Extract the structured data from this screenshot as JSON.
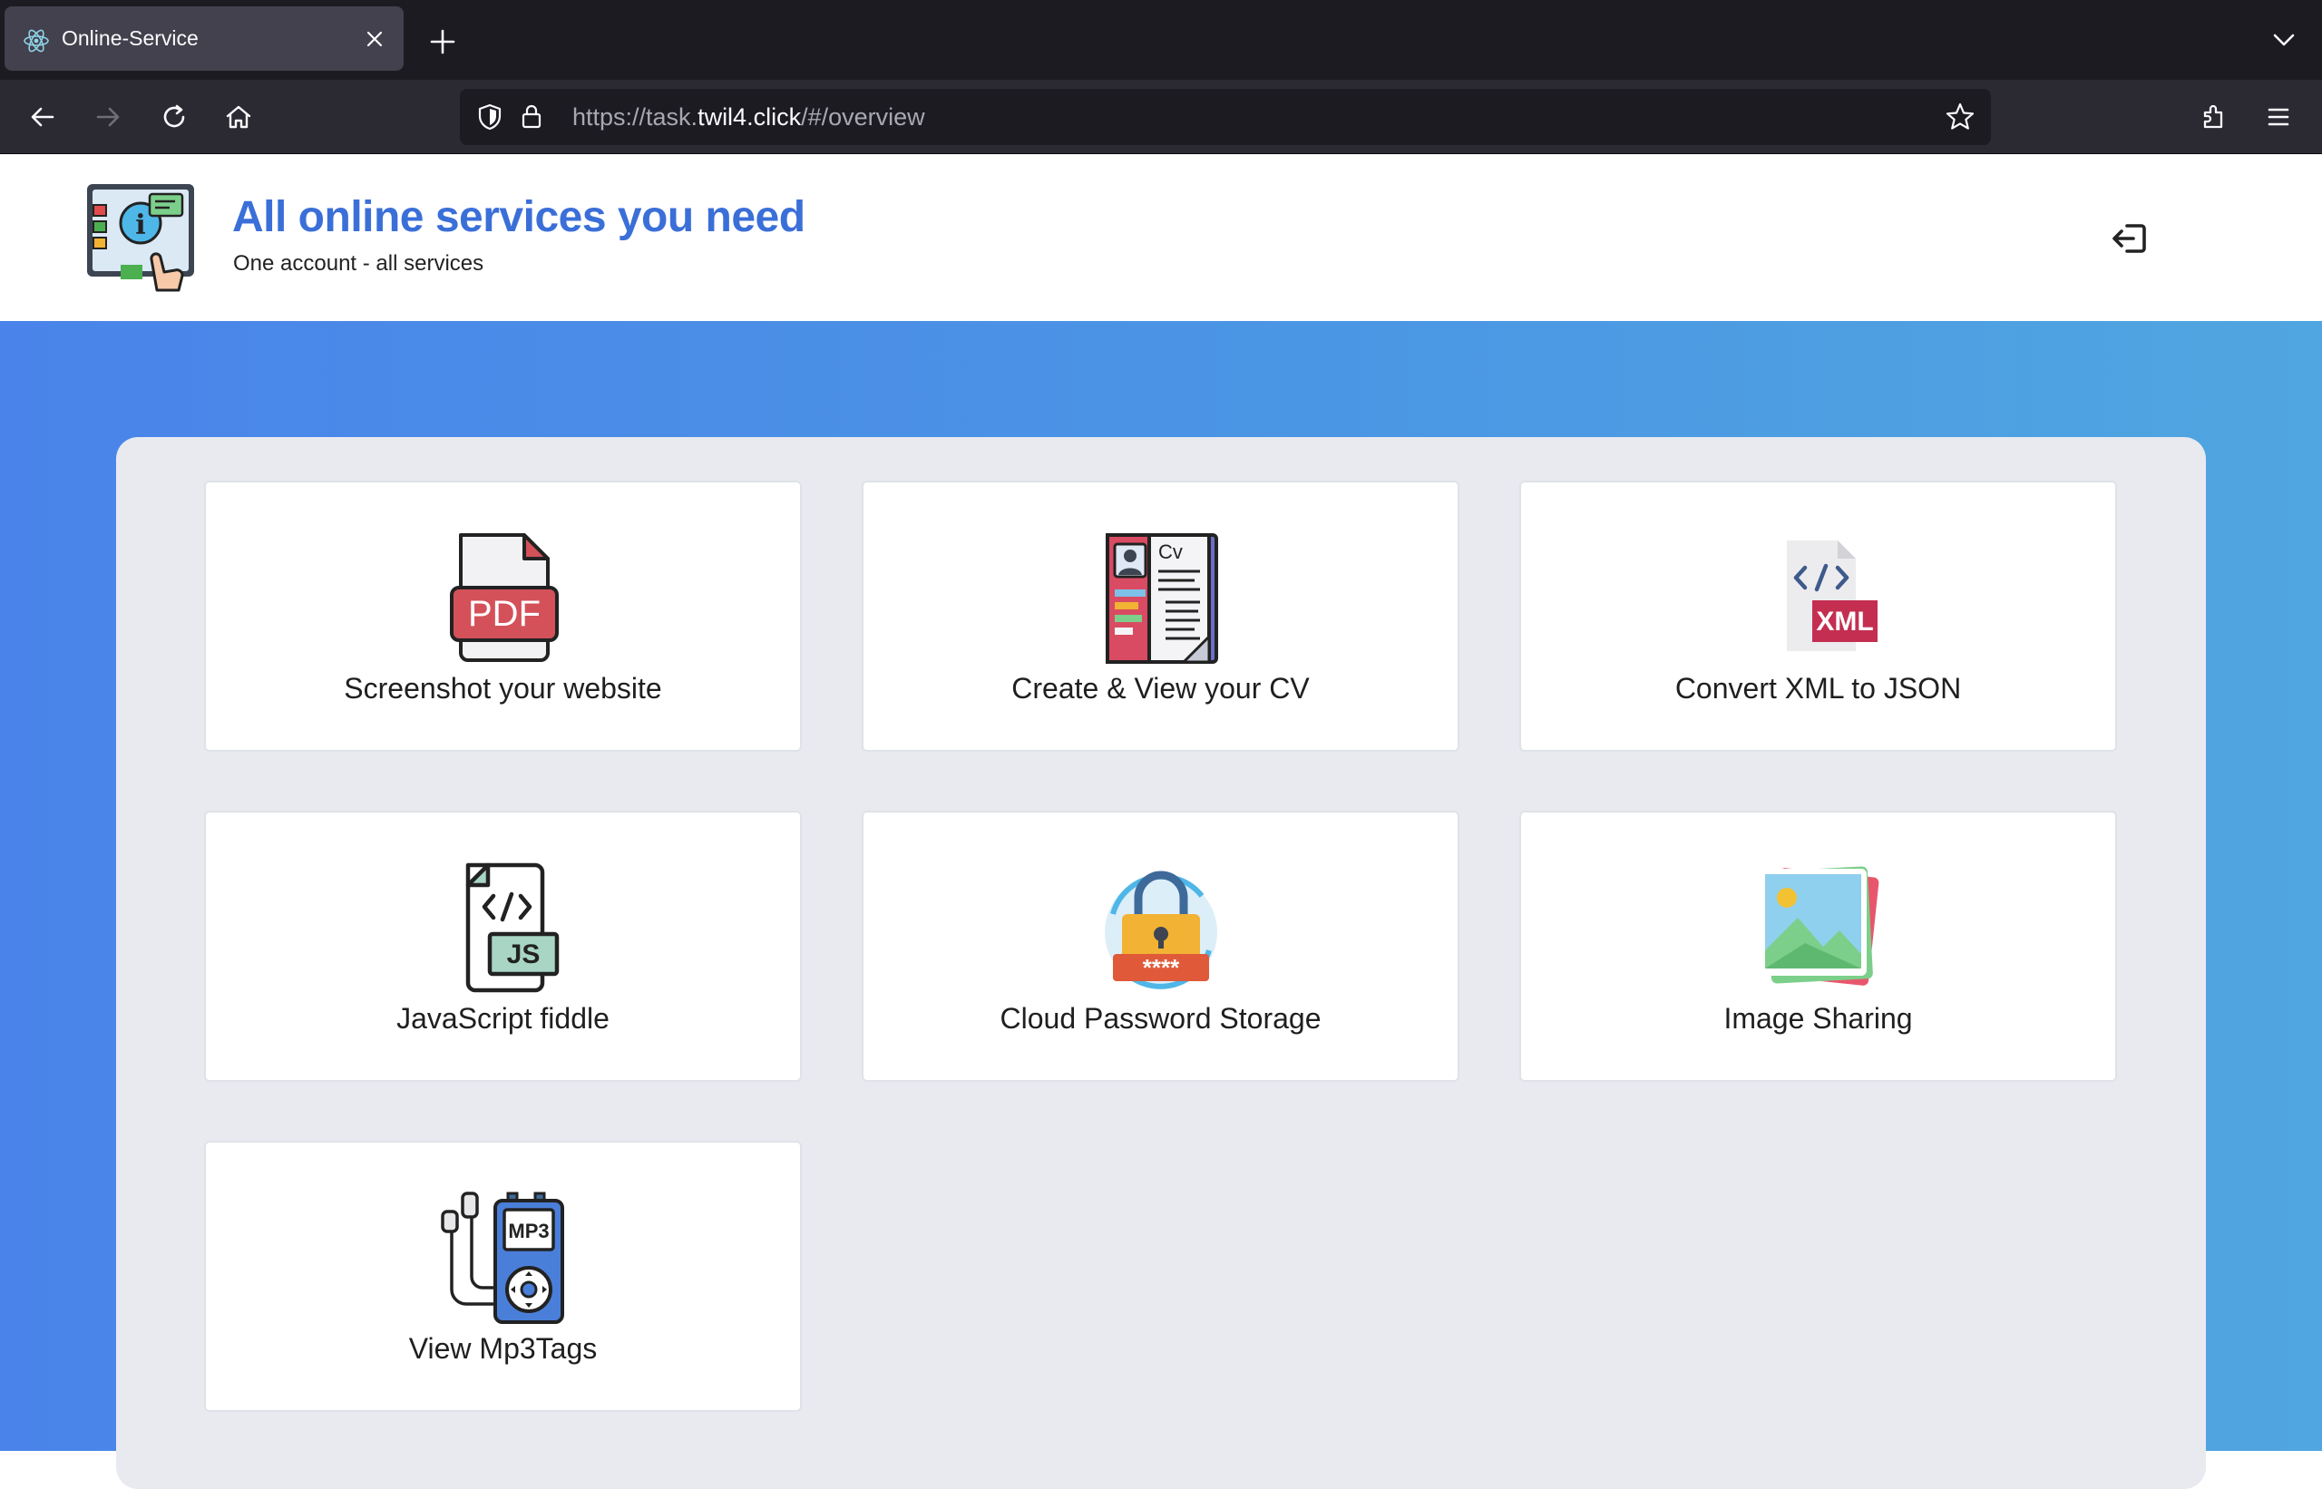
{
  "browser": {
    "tab_title": "Online-Service",
    "url_prefix": "https://task.",
    "url_host": "twil4.click",
    "url_path": "/#/overview"
  },
  "header": {
    "title": "All online services you need",
    "subtitle": "One account - all services"
  },
  "services": [
    {
      "label": "Screenshot your website",
      "icon": "pdf-icon"
    },
    {
      "label": "Create & View your CV",
      "icon": "cv-icon"
    },
    {
      "label": "Convert XML to JSON",
      "icon": "xml-icon"
    },
    {
      "label": "JavaScript fiddle",
      "icon": "js-file-icon"
    },
    {
      "label": "Cloud Password Storage",
      "icon": "padlock-icon"
    },
    {
      "label": "Image Sharing",
      "icon": "image-gallery-icon"
    },
    {
      "label": "View Mp3Tags",
      "icon": "mp3-player-icon"
    }
  ],
  "colors": {
    "title_blue": "#3b6fd8",
    "gradient_start": "#4a84ea",
    "gradient_end": "#50a6e0",
    "panel": "#e8eaf0"
  }
}
